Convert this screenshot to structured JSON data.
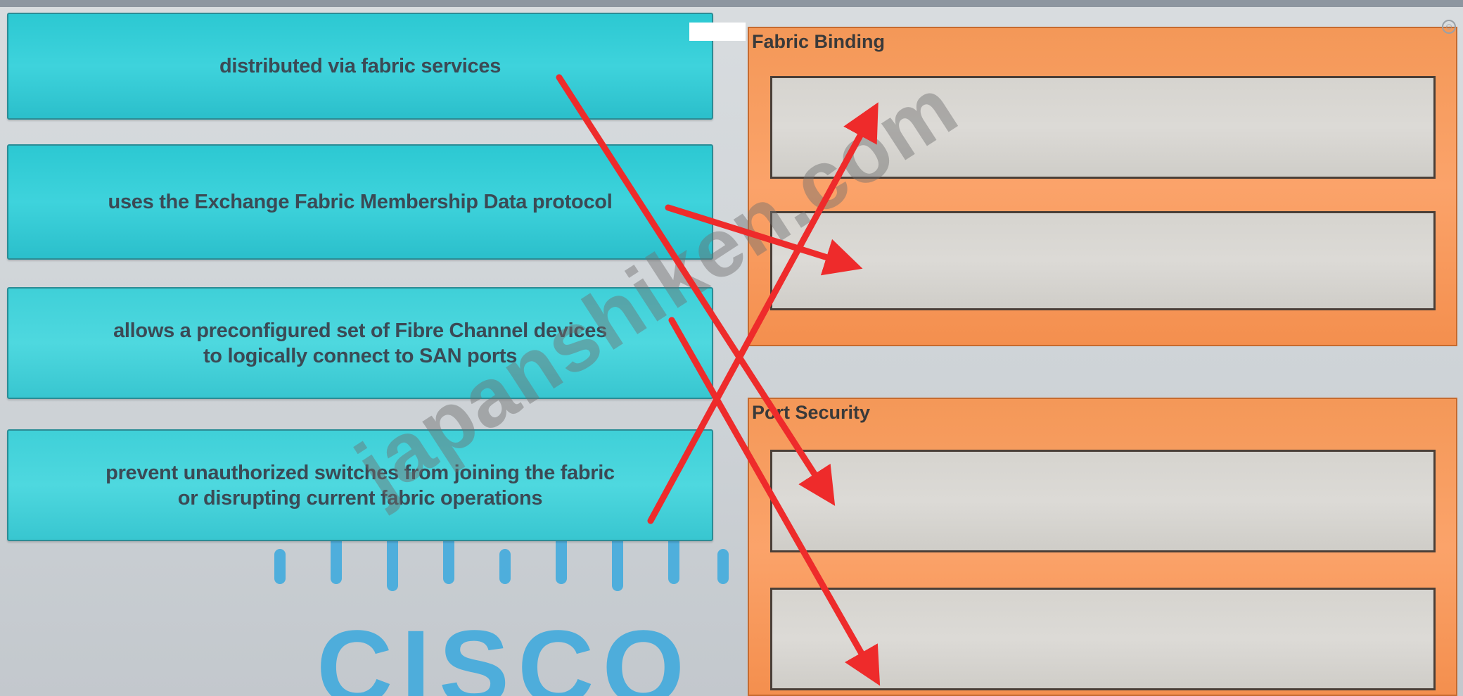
{
  "sources": [
    {
      "text": "distributed via fabric services"
    },
    {
      "text": "uses the Exchange Fabric Membership Data protocol"
    },
    {
      "line1": "allows a preconfigured set of Fibre Channel devices",
      "line2": "to logically connect to SAN ports"
    },
    {
      "line1": "prevent unauthorized switches from joining the fabric",
      "line2": "or disrupting current fabric operations"
    }
  ],
  "targets": [
    {
      "label": "Fabric Binding"
    },
    {
      "label": "Port Security"
    }
  ],
  "watermark": "japanshiken.com",
  "logo": {
    "text": "CISCO"
  },
  "colors": {
    "source": "#2cc8d2",
    "target": "#f89d62",
    "slot": "#d7d5d0",
    "arrow": "#ee2b2b"
  }
}
